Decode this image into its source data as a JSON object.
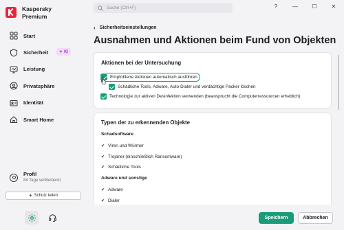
{
  "brand": {
    "line1": "Kaspersky",
    "line2": "Premium"
  },
  "sidebar": {
    "items": [
      {
        "label": "Start",
        "icon": "grid-icon"
      },
      {
        "label": "Sicherheit",
        "icon": "shield-icon"
      },
      {
        "label": "Leistung",
        "icon": "monitor-icon"
      },
      {
        "label": "Privatsphäre",
        "icon": "privacy-icon"
      },
      {
        "label": "Identität",
        "icon": "id-card-icon"
      },
      {
        "label": "Smart Home",
        "icon": "home-icon"
      }
    ],
    "ki_badge": "KI",
    "profile": {
      "name": "Profil",
      "sub": "84 Tage verbleibend"
    },
    "share_button": "Schutz teilen"
  },
  "search": {
    "placeholder": "Suche (Ctrl+F)"
  },
  "window": {
    "help": "?",
    "minimize": "—",
    "maximize": "☐",
    "close": "✕"
  },
  "header": {
    "breadcrumb": "Sicherheitseinstellungen",
    "title": "Ausnahmen und Aktionen beim Fund von Objekten"
  },
  "section1": {
    "title": "Aktionen bei der Untersuchung",
    "options": [
      {
        "label": "Empfohlene Aktionen automatisch ausführen",
        "checked": true
      },
      {
        "label": "Schädliche Tools, Adware, Auto-Dialer und verdächtige Packer löschen",
        "checked": true
      },
      {
        "label": "Technologie zur aktiven Desinfektion verwenden (beansprucht die Computerressourcen erheblich)",
        "checked": true
      }
    ]
  },
  "section2": {
    "title": "Typen der zu erkennenden Objekte",
    "groups": [
      {
        "title": "Schadsoftware",
        "items": [
          "Viren und Würmer",
          "Trojaner (einschließlich Ransomware)",
          "Schädliche Tools"
        ]
      },
      {
        "title": "Adware und sonstige",
        "items": [
          "Adware",
          "Dialer"
        ]
      }
    ]
  },
  "footer": {
    "save": "Speichern",
    "cancel": "Abbrechen"
  },
  "colors": {
    "accent": "#1a9b7a",
    "brand": "#e8253a",
    "ki": "#a33fc0"
  }
}
